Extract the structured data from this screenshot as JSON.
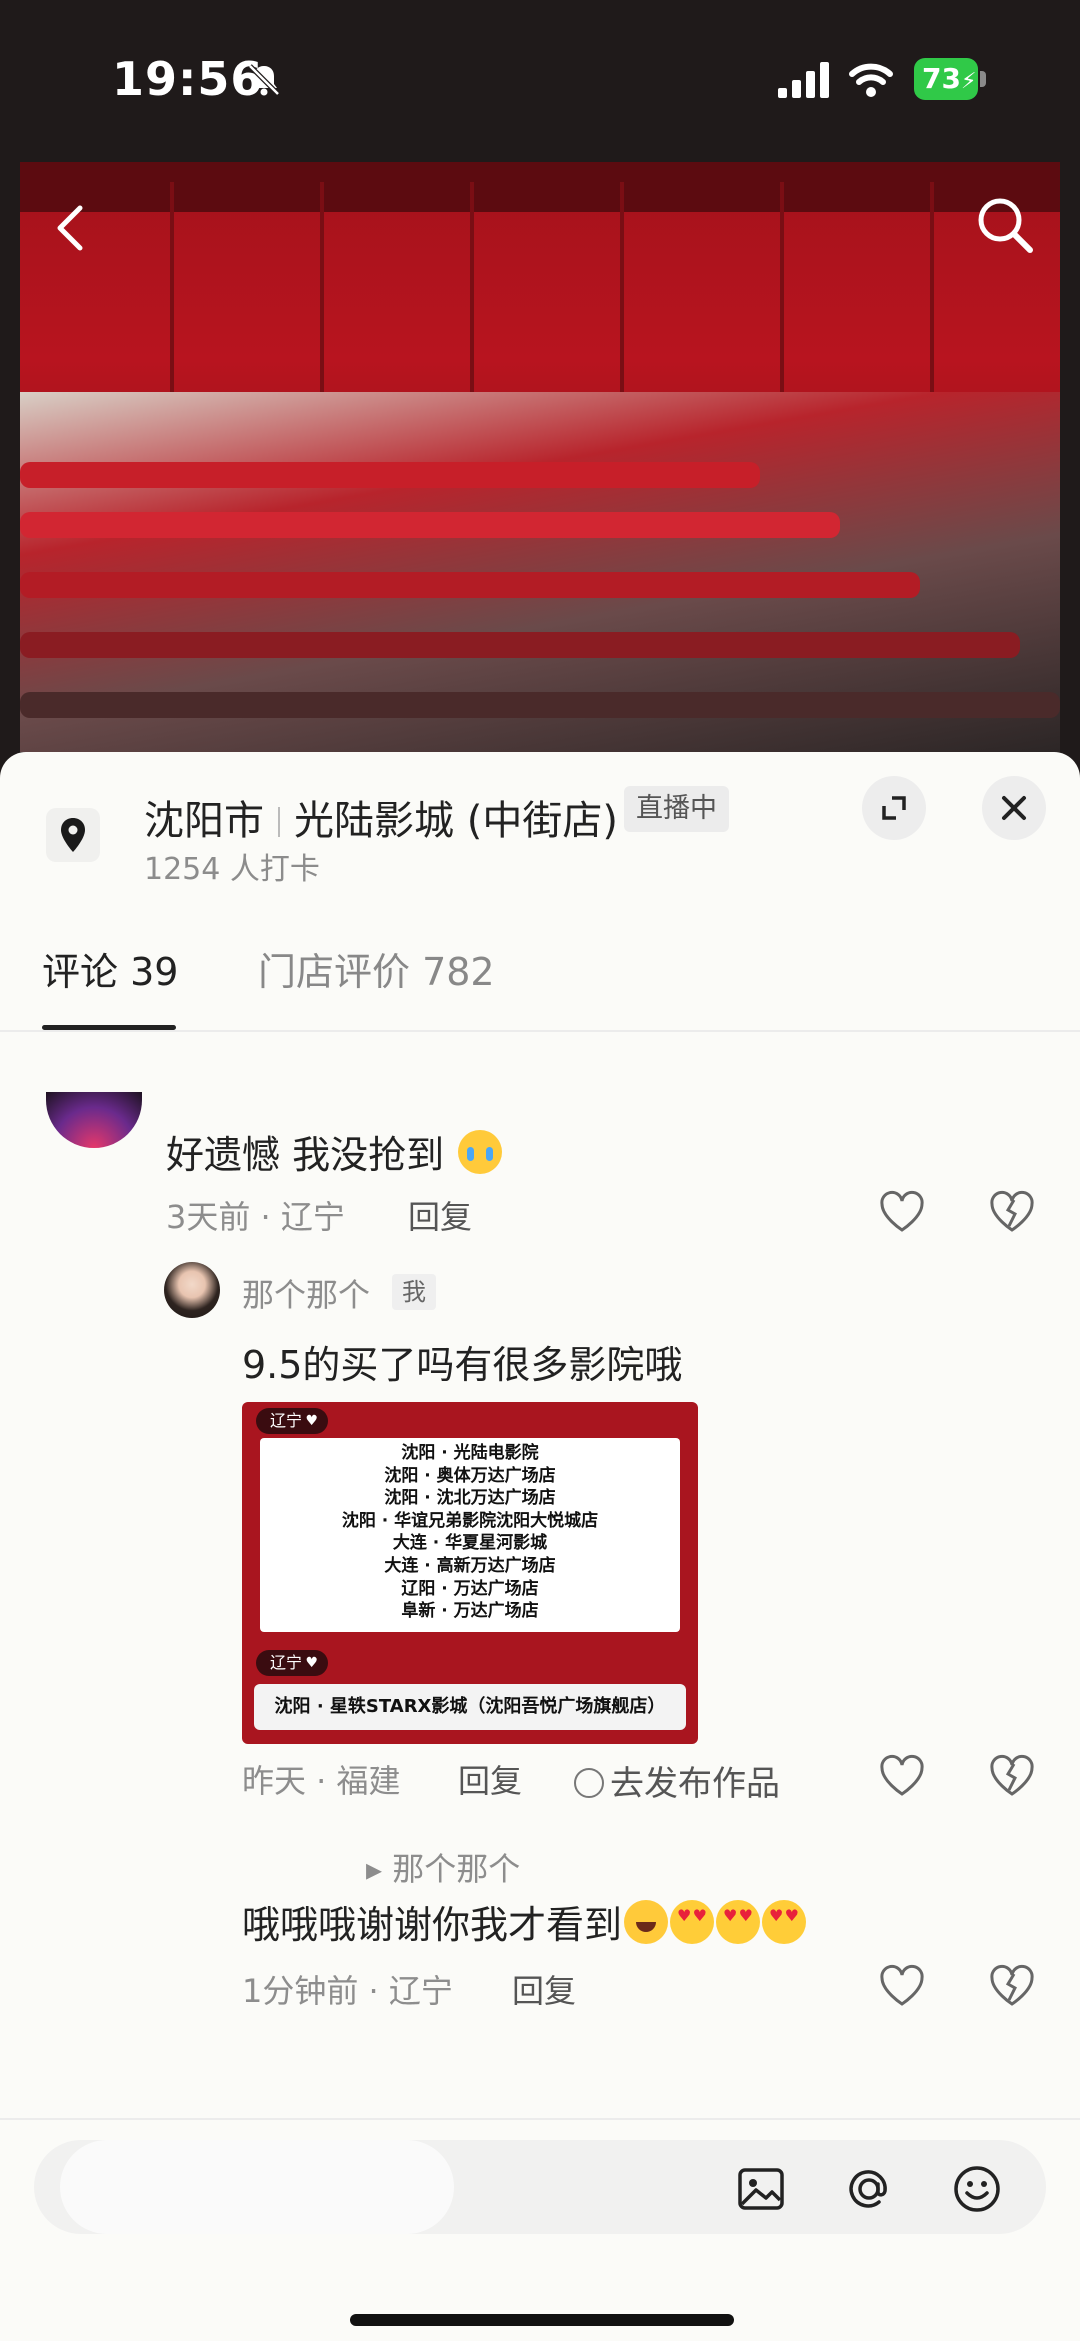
{
  "status_bar": {
    "time": "19:56",
    "battery": "73"
  },
  "location": {
    "city": "沈阳市",
    "name": "光陆影城 (中街店)",
    "live_badge": "直播中",
    "checkins": "1254 人打卡"
  },
  "tabs": [
    {
      "label": "评论 39",
      "active": true
    },
    {
      "label": "门店评价 782",
      "active": false
    }
  ],
  "comments": [
    {
      "text": "好遗憾 我没抢到",
      "emoji": "crying-face",
      "meta": "3天前 · 辽宁",
      "reply_label": "回复"
    },
    {
      "author": "那个那个",
      "author_badge": "我",
      "text": "9.5的买了吗有很多影院哦",
      "card": {
        "tag1": "辽宁",
        "list": [
          "沈阳 · 光陆电影院",
          "沈阳 · 奥体万达广场店",
          "沈阳 · 沈北万达广场店",
          "沈阳 · 华谊兄弟影院沈阳大悦城店",
          "大连 · 华夏星河影城",
          "大连 · 高新万达广场店",
          "辽阳 · 万达广场店",
          "阜新 · 万达广场店"
        ],
        "tag2": "辽宁",
        "bottom": "沈阳 · 星轶STARX影城（沈阳吾悦广场旗舰店）"
      },
      "meta": "昨天 · 福建",
      "reply_label": "回复",
      "share_label": "去发布作品"
    },
    {
      "reply_to": "▸ 那个那个",
      "text": "哦哦哦谢谢你我才看到",
      "emojis": [
        "rofl-face",
        "heart-eyes-face",
        "heart-eyes-face",
        "heart-eyes-face"
      ],
      "meta": "1分钟前 · 辽宁",
      "reply_label": "回复"
    }
  ],
  "input": {
    "placeholder": ""
  },
  "colors": {
    "accent": "#222222",
    "live_bg": "#ececec",
    "battery": "#30c948",
    "card_red": "#a9151f"
  }
}
